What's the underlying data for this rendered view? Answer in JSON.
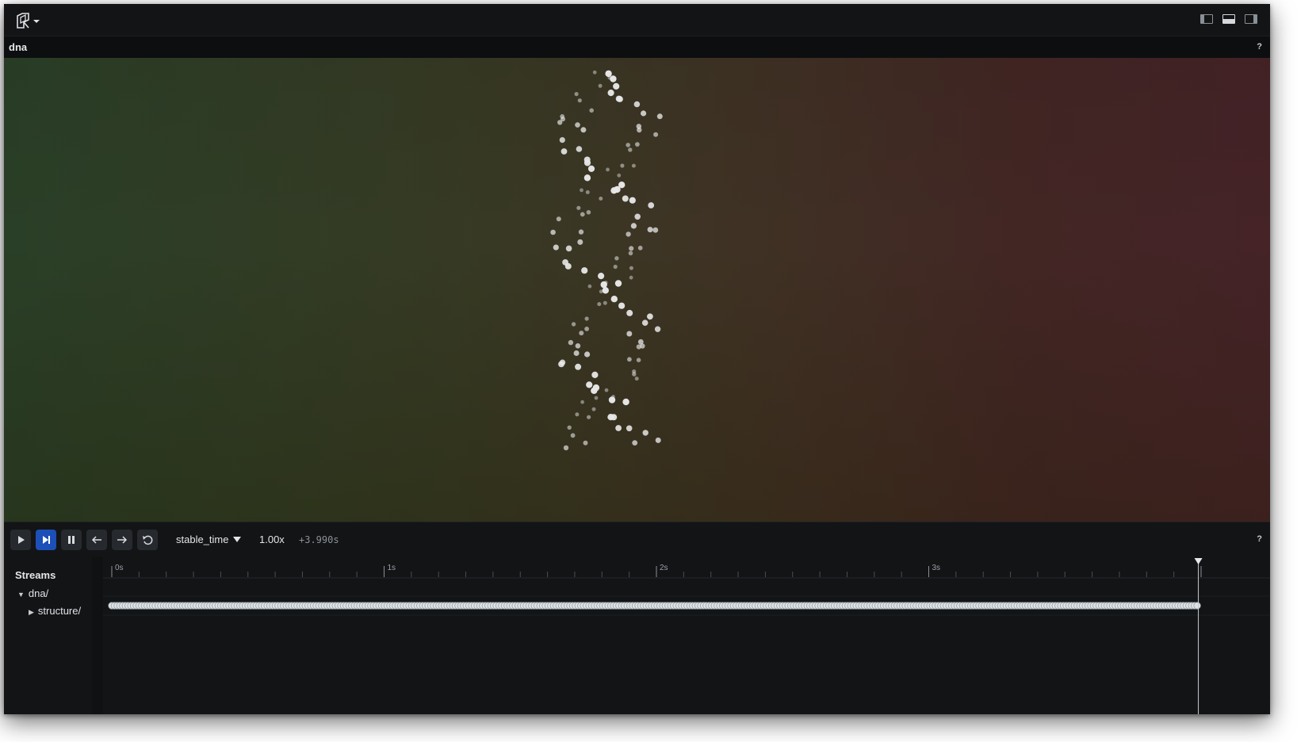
{
  "app": {
    "logo_icon": "rerun-logo-icon",
    "panel_toggles": [
      "left-panel-toggle-icon",
      "bottom-panel-toggle-icon",
      "right-panel-toggle-icon"
    ]
  },
  "view": {
    "title": "dna",
    "help": "?"
  },
  "timebar": {
    "buttons": [
      "play-icon",
      "play-to-end-icon",
      "pause-icon",
      "step-back-icon",
      "step-forward-icon",
      "loop-icon"
    ],
    "active_button": "play-to-end-icon",
    "timeline": "stable_time",
    "speed": "1.00x",
    "current_time": "+3.990s",
    "help": "?"
  },
  "streams": {
    "title": "Streams",
    "tree": [
      {
        "label": "dna/",
        "expanded": true
      },
      {
        "label": "structure/",
        "expanded": false
      }
    ],
    "ruler_labels": [
      "0s",
      "1s",
      "2s",
      "3s"
    ],
    "time_cursor_fraction": 1.0
  },
  "colors": {
    "active_button": "#1c4fb8",
    "viewport_left": "#2a3f27",
    "viewport_right": "#452327"
  }
}
